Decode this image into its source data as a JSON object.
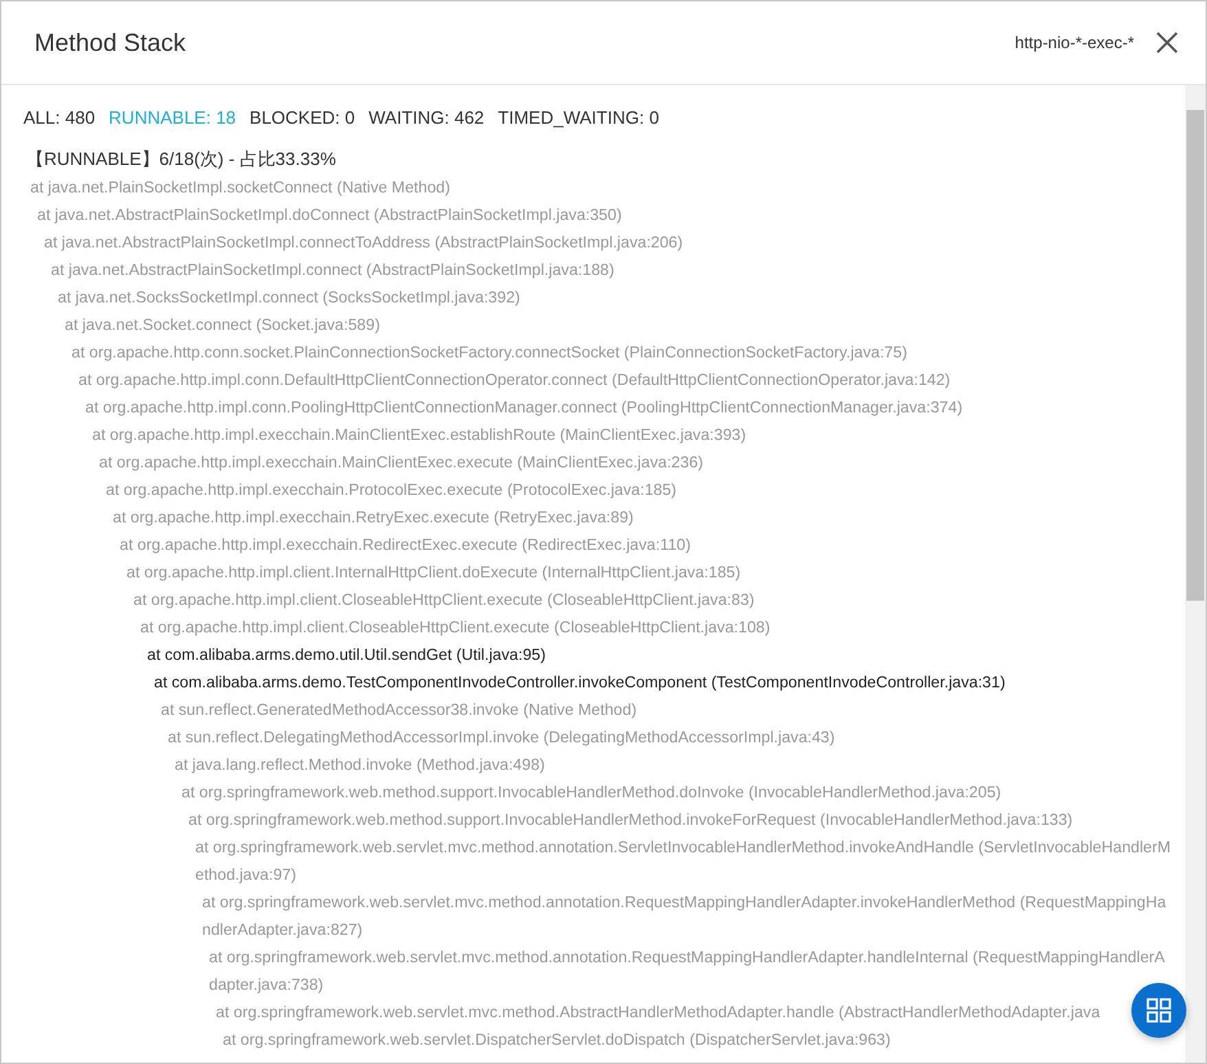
{
  "dialog": {
    "title": "Method Stack",
    "thread_filter": "http-nio-*-exec-*"
  },
  "states": [
    {
      "label": "ALL: 480",
      "selected": false
    },
    {
      "label": "RUNNABLE: 18",
      "selected": true
    },
    {
      "label": "BLOCKED: 0",
      "selected": false
    },
    {
      "label": "WAITING: 462",
      "selected": false
    },
    {
      "label": "TIMED_WAITING: 0",
      "selected": false
    }
  ],
  "stack_heading": "【RUNNABLE】6/18(次) - 占比33.33%",
  "frames": [
    {
      "text": "at java.net.PlainSocketImpl.socketConnect (Native Method)",
      "highlighted": false
    },
    {
      "text": "at java.net.AbstractPlainSocketImpl.doConnect (AbstractPlainSocketImpl.java:350)",
      "highlighted": false
    },
    {
      "text": "at java.net.AbstractPlainSocketImpl.connectToAddress (AbstractPlainSocketImpl.java:206)",
      "highlighted": false
    },
    {
      "text": "at java.net.AbstractPlainSocketImpl.connect (AbstractPlainSocketImpl.java:188)",
      "highlighted": false
    },
    {
      "text": "at java.net.SocksSocketImpl.connect (SocksSocketImpl.java:392)",
      "highlighted": false
    },
    {
      "text": "at java.net.Socket.connect (Socket.java:589)",
      "highlighted": false
    },
    {
      "text": "at org.apache.http.conn.socket.PlainConnectionSocketFactory.connectSocket (PlainConnectionSocketFactory.java:75)",
      "highlighted": false
    },
    {
      "text": "at org.apache.http.impl.conn.DefaultHttpClientConnectionOperator.connect (DefaultHttpClientConnectionOperator.java:142)",
      "highlighted": false
    },
    {
      "text": "at org.apache.http.impl.conn.PoolingHttpClientConnectionManager.connect (PoolingHttpClientConnectionManager.java:374)",
      "highlighted": false
    },
    {
      "text": "at org.apache.http.impl.execchain.MainClientExec.establishRoute (MainClientExec.java:393)",
      "highlighted": false
    },
    {
      "text": "at org.apache.http.impl.execchain.MainClientExec.execute (MainClientExec.java:236)",
      "highlighted": false
    },
    {
      "text": "at org.apache.http.impl.execchain.ProtocolExec.execute (ProtocolExec.java:185)",
      "highlighted": false
    },
    {
      "text": "at org.apache.http.impl.execchain.RetryExec.execute (RetryExec.java:89)",
      "highlighted": false
    },
    {
      "text": "at org.apache.http.impl.execchain.RedirectExec.execute (RedirectExec.java:110)",
      "highlighted": false
    },
    {
      "text": "at org.apache.http.impl.client.InternalHttpClient.doExecute (InternalHttpClient.java:185)",
      "highlighted": false
    },
    {
      "text": "at org.apache.http.impl.client.CloseableHttpClient.execute (CloseableHttpClient.java:83)",
      "highlighted": false
    },
    {
      "text": "at org.apache.http.impl.client.CloseableHttpClient.execute (CloseableHttpClient.java:108)",
      "highlighted": false
    },
    {
      "text": "at com.alibaba.arms.demo.util.Util.sendGet (Util.java:95)",
      "highlighted": true
    },
    {
      "text": "at com.alibaba.arms.demo.TestComponentInvodeController.invokeComponent (TestComponentInvodeController.java:31)",
      "highlighted": true
    },
    {
      "text": "at sun.reflect.GeneratedMethodAccessor38.invoke (Native Method)",
      "highlighted": false
    },
    {
      "text": "at sun.reflect.DelegatingMethodAccessorImpl.invoke (DelegatingMethodAccessorImpl.java:43)",
      "highlighted": false
    },
    {
      "text": "at java.lang.reflect.Method.invoke (Method.java:498)",
      "highlighted": false
    },
    {
      "text": "at org.springframework.web.method.support.InvocableHandlerMethod.doInvoke (InvocableHandlerMethod.java:205)",
      "highlighted": false
    },
    {
      "text": "at org.springframework.web.method.support.InvocableHandlerMethod.invokeForRequest (InvocableHandlerMethod.java:133)",
      "highlighted": false
    },
    {
      "text": "at org.springframework.web.servlet.mvc.method.annotation.ServletInvocableHandlerMethod.invokeAndHandle (ServletInvocableHandlerMethod.java:97)",
      "highlighted": false
    },
    {
      "text": "at org.springframework.web.servlet.mvc.method.annotation.RequestMappingHandlerAdapter.invokeHandlerMethod (RequestMappingHandlerAdapter.java:827)",
      "highlighted": false
    },
    {
      "text": "at org.springframework.web.servlet.mvc.method.annotation.RequestMappingHandlerAdapter.handleInternal (RequestMappingHandlerAdapter.java:738)",
      "highlighted": false
    },
    {
      "text": "at org.springframework.web.servlet.mvc.method.AbstractHandlerMethodAdapter.handle (AbstractHandlerMethodAdapter.java",
      "highlighted": false
    },
    {
      "text": "at org.springframework.web.servlet.DispatcherServlet.doDispatch (DispatcherServlet.java:963)",
      "highlighted": false
    }
  ]
}
